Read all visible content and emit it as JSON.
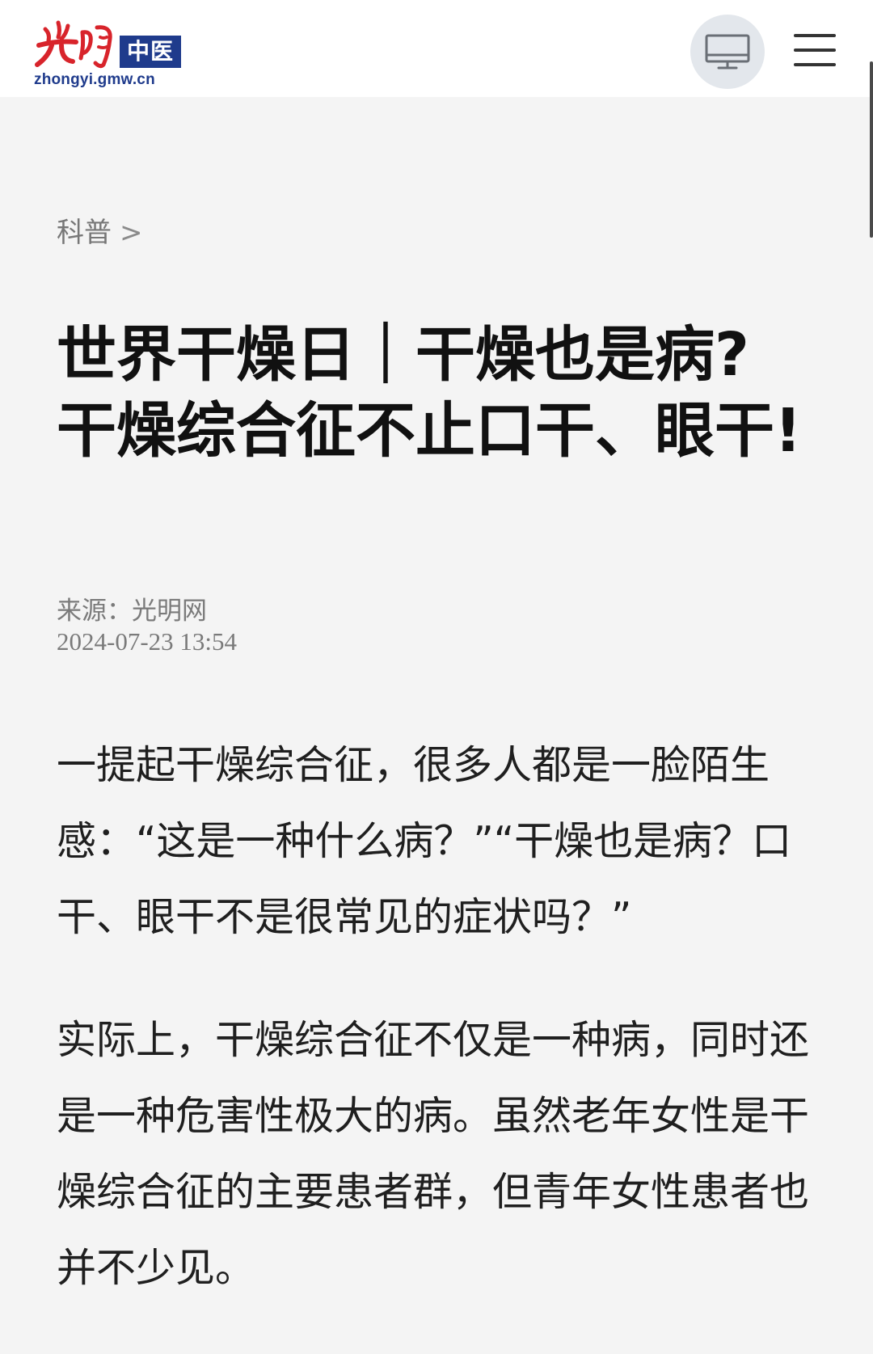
{
  "header": {
    "logo_badge": "中医",
    "logo_url": "zhongyi.gmw.cn",
    "desktop_icon": "desktop-monitor-icon",
    "menu_icon": "hamburger-menu-icon"
  },
  "breadcrumb": {
    "category": "科普",
    "separator": ">"
  },
  "article": {
    "title": "世界干燥日｜干燥也是病?干燥综合征不止口干、眼干!",
    "source": "来源：光明网",
    "date": "2024-07-23 13:54",
    "paragraphs": [
      "一提起干燥综合征，很多人都是一脸陌生感：“这是一种什么病？”“干燥也是病？口干、眼干不是很常见的症状吗？”",
      "实际上，干燥综合征不仅是一种病，同时还是一种危害性极大的病。虽然老年女性是干燥综合征的主要患者群，但青年女性患者也并不少见。"
    ]
  },
  "colors": {
    "brand_red": "#d8242b",
    "brand_blue": "#1f3b8c",
    "background": "#f4f4f4",
    "header_bg": "#ffffff"
  }
}
